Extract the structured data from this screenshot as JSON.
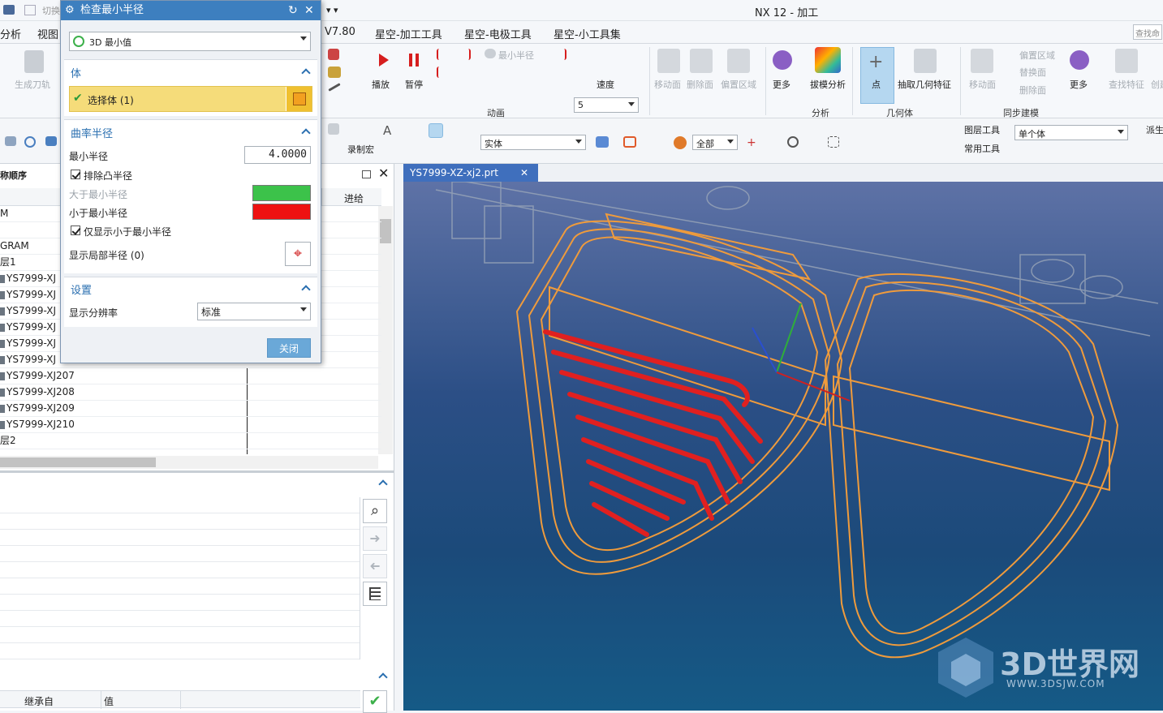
{
  "app": {
    "title": "NX 12 - 加工",
    "quick_cut": "切换"
  },
  "menu": {
    "items": [
      "分析",
      "视图",
      "V7.80",
      "星空-加工工具",
      "星空-电极工具",
      "星空-小工具集"
    ],
    "search_placeholder": "查找命"
  },
  "ribbon": {
    "gen_toolpath": "生成刀轨",
    "play": "播放",
    "pause": "暂停",
    "min_radius": "最小半径",
    "speed_label": "速度",
    "speed_value": "5",
    "anim_group": "动画",
    "move_face": "移动面",
    "delete_face": "删除面",
    "offset_region": "偏置区域",
    "more": "更多",
    "draft_analysis": "拔模分析",
    "analysis_group": "分析",
    "point": "点",
    "extract_geom": "抽取几何特征",
    "geometry_group": "几何体",
    "move_face2": "移动面",
    "offset_region2": "偏置区域",
    "replace_face": "替换面",
    "delete_face2": "删除面",
    "more2": "更多",
    "sync_group": "同步建模",
    "find_feature": "查找特征",
    "create": "创建"
  },
  "ribbon2": {
    "record_macro": "录制宏",
    "filter_value": "实体",
    "scope_value": "全部",
    "layer_tools": "图层工具",
    "common_tools": "常用工具",
    "single_body": "单个体",
    "derive": "派生"
  },
  "tab": {
    "file": "YS7999-XZ-xj2.prt"
  },
  "navigator": {
    "col_order": "称顺序",
    "col_feed": "进给",
    "rows": [
      "M",
      "",
      "GRAM",
      "层1",
      "YS7999-XJ",
      "YS7999-XJ",
      "YS7999-XJ",
      "YS7999-XJ",
      "YS7999-XJ",
      "YS7999-XJ",
      "YS7999-XJ207",
      "YS7999-XJ208",
      "YS7999-XJ209",
      "YS7999-XJ210",
      "层2"
    ]
  },
  "detail": {
    "col_inherit": "继承自",
    "col_value": "值"
  },
  "dialog": {
    "title": "检查最小半径",
    "mode": "3D 最小值",
    "body_section": "体",
    "select_body": "选择体 (1)",
    "curvature_section": "曲率半径",
    "min_radius_label": "最小半径",
    "min_radius_value": "4.0000",
    "exclude_convex": "排除凸半径",
    "greater_label": "大于最小半径",
    "less_label": "小于最小半径",
    "only_less": "仅显示小于最小半径",
    "local_radius": "显示局部半径 (0)",
    "settings_section": "设置",
    "resolution_label": "显示分辨率",
    "resolution_value": "标准",
    "close": "关闭",
    "greater_color": "#3cc24a",
    "less_color": "#ee1111"
  },
  "watermark": {
    "brand": "3D世界网",
    "url": "WWW.3DSJW.COM"
  }
}
